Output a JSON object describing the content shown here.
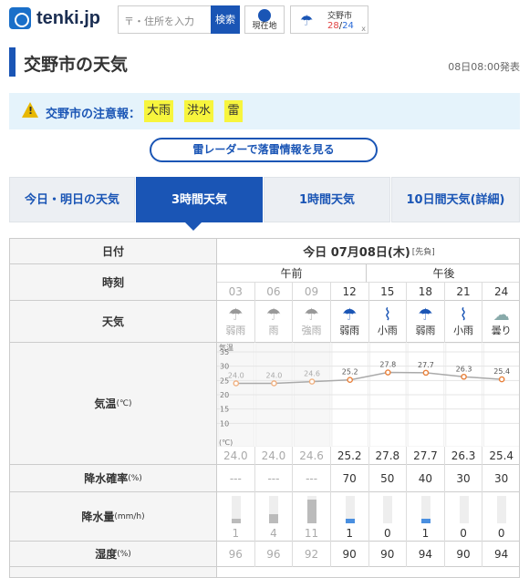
{
  "header": {
    "logo": "tenki.jp",
    "search_placeholder": "〒・住所を入力",
    "search_button": "検索",
    "location_button": "現在地",
    "mini_city": "交野市",
    "mini_hi": "28",
    "mini_sep": "/",
    "mini_lo": "24",
    "mini_close": "x"
  },
  "page": {
    "title": "交野市の天気",
    "issued": "08日08:00発表"
  },
  "warning": {
    "label": "交野市の注意報：",
    "tags": [
      "大雨",
      "洪水",
      "雷"
    ]
  },
  "radar_link": "雷レーダーで落雷情報を見る",
  "tabs": [
    {
      "label": "今日・明日の天気",
      "active": false
    },
    {
      "label": "3時間天気",
      "active": true
    },
    {
      "label": "1時間天気",
      "active": false
    },
    {
      "label": "10日間天気(詳細)",
      "active": false
    }
  ],
  "table": {
    "date_label": "日付",
    "date": "今日 07月08日(木)",
    "date_note": "[先負]",
    "time_label": "時刻",
    "am": "午前",
    "pm": "午後",
    "hours": [
      "03",
      "06",
      "09",
      "12",
      "15",
      "18",
      "21",
      "24"
    ],
    "past_count": 3,
    "weather_label": "天気",
    "weather": [
      {
        "icon": "umbrella-icon",
        "text": "弱雨"
      },
      {
        "icon": "umbrella-icon",
        "text": "雨"
      },
      {
        "icon": "umbrella-icon",
        "text": "強雨"
      },
      {
        "icon": "umbrella-icon",
        "text": "弱雨"
      },
      {
        "icon": "closed-umbrella-icon",
        "text": "小雨"
      },
      {
        "icon": "umbrella-icon",
        "text": "弱雨"
      },
      {
        "icon": "closed-umbrella-icon",
        "text": "小雨"
      },
      {
        "icon": "cloud-icon",
        "text": "曇り"
      }
    ],
    "temp_label": "気温",
    "temp_unit": "(℃)",
    "temp_axis_label": "気温",
    "temp_axis_unit": "(℃)",
    "temp_ticks": [
      "35",
      "30",
      "25",
      "20",
      "15",
      "10"
    ],
    "temps": [
      "24.0",
      "24.0",
      "24.6",
      "25.2",
      "27.8",
      "27.7",
      "26.3",
      "25.4"
    ],
    "precip_prob_label": "降水確率",
    "precip_prob_unit": "(%)",
    "precip_prob": [
      "---",
      "---",
      "---",
      "70",
      "50",
      "40",
      "30",
      "30"
    ],
    "precip_amt_label": "降水量",
    "precip_amt_unit": "(mm/h)",
    "precip_amt": [
      "1",
      "4",
      "11",
      "1",
      "0",
      "1",
      "0",
      "0"
    ],
    "humidity_label": "湿度",
    "humidity_unit": "(%)",
    "humidity": [
      "96",
      "96",
      "92",
      "90",
      "90",
      "94",
      "90",
      "94"
    ]
  },
  "colors": {
    "accent": "#1a55b5",
    "warning_tag": "#f7f53d",
    "hi": "#e04040",
    "lo": "#2b6bd8"
  }
}
